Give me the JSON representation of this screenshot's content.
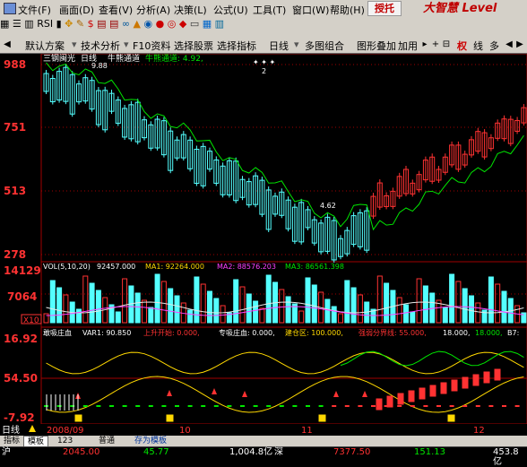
{
  "menu": {
    "items": [
      "文件(F)",
      "画面(D)",
      "查看(V)",
      "分析(A)",
      "决策(L)",
      "公式(U)",
      "工具(T)",
      "窗口(W)",
      "帮助(H)"
    ],
    "brand_button": "授托",
    "brand_logo": "大智慧 Level",
    "tool_rsi": "RSI"
  },
  "toolbar": {
    "left_items": [
      "默认方案",
      "技术分析",
      "F10资料",
      "选择股票",
      "选择指标"
    ],
    "right_items": [
      "日线",
      "多图组合",
      "图形叠加",
      "加用"
    ],
    "side_items": [
      "权",
      "线",
      "多"
    ]
  },
  "main_chart": {
    "stock_name": "三钢闽光",
    "period_label": "日线",
    "indicator_label": "牛熊通道",
    "indicator_value": "牛熊通道: 4.92,",
    "y_ticks": [
      "988",
      "751",
      "513",
      "278"
    ],
    "high_label": "9.88",
    "low_label": "4.62",
    "marker_label": "2"
  },
  "volume_panel": {
    "title": "VOL(5,10,20)",
    "vol": "92457.000",
    "ma1": "MA1: 92264.000",
    "ma2": "MA2: 88576.203",
    "ma3": "MA3: 86561.398",
    "y_ticks": [
      "14129",
      "7064"
    ],
    "unit": "X10"
  },
  "indicator_panel": {
    "title": "敢吸庄血",
    "var1": "VAR1: 90.850",
    "label2": "上升开始: 0.000,",
    "label3": "专吸庄血: 0.000,",
    "label4": "建仓区: 100.000,",
    "label5": "强弱分界线: 55.000,",
    "label6": "18.000,",
    "label7": "18.000,",
    "label8": "B7: ",
    "y_ticks": [
      "16.92",
      "54.50",
      "-7.92"
    ]
  },
  "time_axis": {
    "period": "日线",
    "labels": [
      "2008/09",
      "10",
      "11",
      "12"
    ]
  },
  "tabs": [
    "指标",
    "模板",
    "123",
    "普通",
    "存为模板"
  ],
  "status": {
    "index_name": "沪",
    "v1": "2045.00",
    "v2": "45.77",
    "v3": "1,004.8亿",
    "v4": "深",
    "v5": "7377.50",
    "v6": "151.13",
    "v7": "453.8亿"
  },
  "colors": {
    "up": "#ff3232",
    "down": "#54ffff",
    "ma_green": "#00e600",
    "ma_white": "#e6e6e6",
    "ma_magenta": "#ff40ff",
    "ma_yellow": "#ffd800",
    "grid_red": "#a00000"
  }
}
